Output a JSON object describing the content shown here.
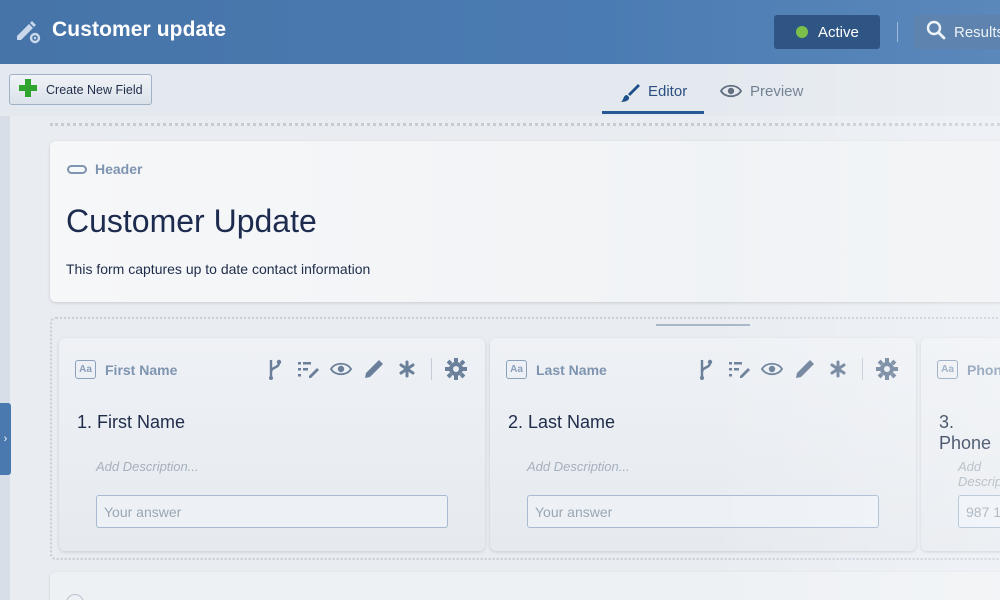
{
  "header": {
    "title": "Customer update",
    "status_label": "Active",
    "results_label": "Results"
  },
  "toolbar": {
    "create_label": "Create New Field",
    "tabs": [
      {
        "label": "Editor",
        "active": true
      },
      {
        "label": "Preview",
        "active": false
      }
    ]
  },
  "header_section": {
    "tag": "Header",
    "title": "Customer Update",
    "description": "This form captures up to date contact information"
  },
  "fields": [
    {
      "tag": "First Name",
      "question": "1. First Name",
      "description_placeholder": "Add Description...",
      "input_placeholder": "Your answer"
    },
    {
      "tag": "Last Name",
      "question": "2. Last Name",
      "description_placeholder": "Add Description...",
      "input_placeholder": "Your answer"
    },
    {
      "tag": "Phone",
      "question": "3. Phone",
      "description_placeholder": "Add Description...",
      "input_placeholder": "987 1"
    }
  ],
  "colors": {
    "brand": "#4674a8",
    "status_dot": "#7cc04b",
    "plus": "#2fa52f"
  }
}
